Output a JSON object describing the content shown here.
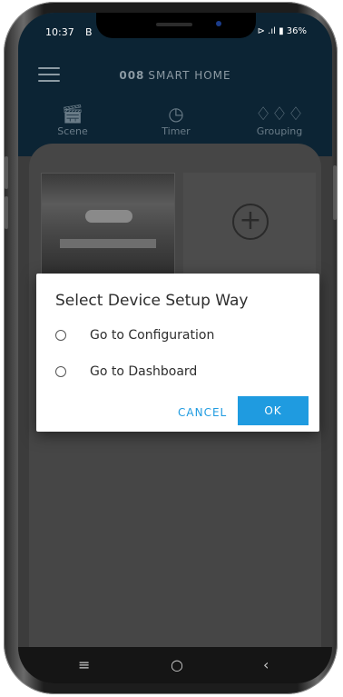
{
  "status": {
    "time": "10:37",
    "notification": "B",
    "right": "⊳ .ıl ▮ 36%"
  },
  "header": {
    "brand_bold": "008",
    "brand_light": "SMART HOME"
  },
  "nav": [
    {
      "label": "Scene",
      "icon": "clapperboard-icon"
    },
    {
      "label": "Timer",
      "icon": "clock-icon"
    },
    {
      "label": "Grouping",
      "icon": "bulbs-icon"
    }
  ],
  "dialog": {
    "title": "Select Device Setup Way",
    "options": [
      {
        "label": "Go to Configuration",
        "selected": false
      },
      {
        "label": "Go to Dashboard",
        "selected": false
      }
    ],
    "cancel_label": "CANCEL",
    "ok_label": "OK"
  },
  "colors": {
    "accent": "#1f9be0",
    "app_bar": "#0c2434",
    "overlay": "#3c3c3c"
  }
}
